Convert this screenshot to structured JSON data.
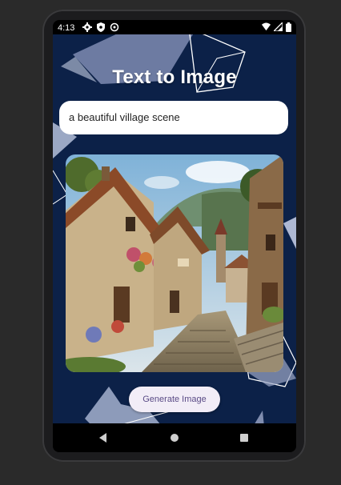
{
  "statusbar": {
    "time": "4:13",
    "icons_left": [
      "gear-icon",
      "shield-icon",
      "sync-icon"
    ],
    "icons_right": [
      "wifi-icon",
      "signal-icon",
      "battery-icon"
    ]
  },
  "app": {
    "title": "Text to Image",
    "prompt_value": "a beautiful village scene",
    "generate_label": "Generate Image",
    "background_color": "#0c2148",
    "button_bg": "#f2edf7",
    "button_text_color": "#5a4b86"
  },
  "navbar": {
    "icons": [
      "back-icon",
      "home-icon",
      "recents-icon"
    ]
  }
}
